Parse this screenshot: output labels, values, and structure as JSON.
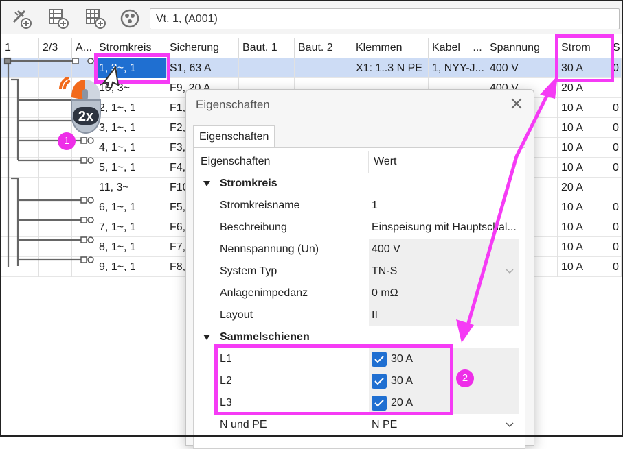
{
  "toolbar": {
    "buttons": [
      {
        "icon": "add-tool-icon"
      },
      {
        "icon": "add-table-icon"
      },
      {
        "icon": "add-grid-icon"
      },
      {
        "icon": "circuit-symbol-icon"
      }
    ],
    "path_value": "Vt. 1,  (A001)"
  },
  "table": {
    "headers": [
      "1",
      "2/3",
      "A...",
      "Stromkreis",
      "Sicherung",
      "Baut. 1",
      "Baut. 2",
      "Klemmen",
      "Kabel",
      "...",
      "Spannung",
      "Strom",
      "S"
    ],
    "rows": [
      {
        "stromkreis": "1, 3~, 1",
        "sicherung": "S1, 63 A",
        "klemmen": "X1: 1..3 N PE",
        "kabel": "1, NYY-J...",
        "spannung": "400 V",
        "strom": "30 A",
        "s": "0"
      },
      {
        "stromkreis": "10, 3~",
        "sicherung": "F9, 20 A",
        "klemmen": "",
        "kabel": "",
        "spannung": "400 V",
        "strom": "20 A",
        "s": ""
      },
      {
        "stromkreis": "2, 1~, 1",
        "sicherung": "F1,",
        "klemmen": "",
        "kabel": "",
        "spannung": "",
        "strom": "10 A",
        "s": "0"
      },
      {
        "stromkreis": "3, 1~, 1",
        "sicherung": "F2,",
        "klemmen": "",
        "kabel": "",
        "spannung": "",
        "strom": "10 A",
        "s": "0"
      },
      {
        "stromkreis": "4, 1~, 1",
        "sicherung": "F3,",
        "klemmen": "",
        "kabel": "",
        "spannung": "",
        "strom": "10 A",
        "s": "0"
      },
      {
        "stromkreis": "5, 1~, 1",
        "sicherung": "F4,",
        "klemmen": "",
        "kabel": "",
        "spannung": "",
        "strom": "10 A",
        "s": "0"
      },
      {
        "stromkreis": "11, 3~",
        "sicherung": "F10",
        "klemmen": "",
        "kabel": "",
        "spannung": "",
        "strom": "20 A",
        "s": ""
      },
      {
        "stromkreis": "6, 1~, 1",
        "sicherung": "F5,",
        "klemmen": "",
        "kabel": "",
        "spannung": "",
        "strom": "10 A",
        "s": "0"
      },
      {
        "stromkreis": "7, 1~, 1",
        "sicherung": "F6,",
        "klemmen": "",
        "kabel": "",
        "spannung": "",
        "strom": "10 A",
        "s": "0"
      },
      {
        "stromkreis": "8, 1~, 1",
        "sicherung": "F7,",
        "klemmen": "",
        "kabel": "",
        "spannung": "",
        "strom": "10 A",
        "s": "0"
      },
      {
        "stromkreis": "9, 1~, 1",
        "sicherung": "F8,",
        "klemmen": "",
        "kabel": "",
        "spannung": "",
        "strom": "10 A",
        "s": "0"
      }
    ]
  },
  "dialog": {
    "title": "Eigenschaften",
    "tab": "Eigenschaften",
    "col_name": "Eigenschaften",
    "col_value": "Wert",
    "group_stromkreis": "Stromkreis",
    "props": [
      {
        "name": "Stromkreisname",
        "value": "1"
      },
      {
        "name": "Beschreibung",
        "value": "Einspeisung mit Hauptschal..."
      },
      {
        "name": "Nennspannung (Un)",
        "value": "400 V"
      },
      {
        "name": "System Typ",
        "value": "TN-S"
      },
      {
        "name": "Anlagenimpedanz",
        "value": "0 mΩ"
      },
      {
        "name": "Layout",
        "value": "II"
      }
    ],
    "group_sammelschienen": "Sammelschienen",
    "busbars": [
      {
        "name": "L1",
        "value": "30 A",
        "checked": true
      },
      {
        "name": "L2",
        "value": "30 A",
        "checked": true
      },
      {
        "name": "L3",
        "value": "20 A",
        "checked": true
      }
    ],
    "npe": {
      "name": "N und PE",
      "value": "N PE"
    }
  },
  "annotations": {
    "mouse_label": "2x",
    "badge_1": "1",
    "badge_2": "2",
    "accent_color": "#f53bf5"
  }
}
